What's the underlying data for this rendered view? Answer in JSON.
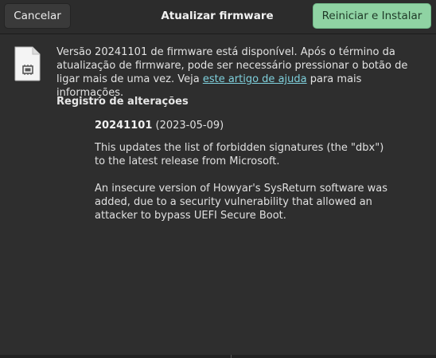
{
  "header": {
    "cancel_label": "Cancelar",
    "title": "Atualizar firmware",
    "install_label": "Reiniciar e Instalar"
  },
  "main": {
    "icon": "firmware-file-icon",
    "intro_before": "Versão 20241101 de firmware está disponível. Após o término da atualização de firmware, pode ser necessário pressionar o botão de ligar mais de uma vez. Veja ",
    "intro_link": "este artigo de ajuda",
    "intro_after": " para mais informações.",
    "changelog_heading": "Registro de alterações",
    "release": {
      "version": "20241101",
      "date": "(2023-05-09)",
      "paragraphs": [
        "This updates the list of forbidden signatures (the \"dbx\") to the latest release from Microsoft.",
        "An insecure version of Howyar's SysReturn software was added, due to a security vulnerability that allowed an attacker to bypass UEFI Secure Boot."
      ]
    }
  },
  "colors": {
    "accent_button": "#8fd3a3",
    "link": "#7fd0dc",
    "background": "#2e2e2e"
  }
}
